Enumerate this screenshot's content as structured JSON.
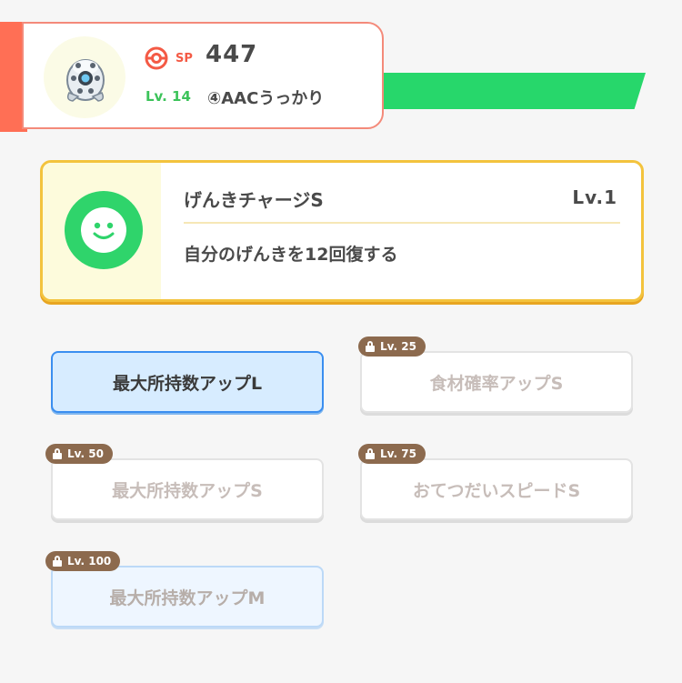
{
  "header": {
    "sp_label": "SP",
    "sp_value": "447",
    "level_label": "Lv. 14",
    "pokemon_name": "④AACうっかり",
    "accent_color": "#ff6f55",
    "stripe_color": "#27d76b"
  },
  "main_skill": {
    "name": "げんきチャージS",
    "level": "Lv.1",
    "description": "自分のげんきを12回復する",
    "icon": "smiley-face-icon",
    "icon_color": "#2fd46b"
  },
  "sub_skills": [
    {
      "label": "最大所持数アップL",
      "lock_level": "",
      "state": "unlocked"
    },
    {
      "label": "食材確率アップS",
      "lock_level": "Lv. 25",
      "state": "locked"
    },
    {
      "label": "最大所持数アップS",
      "lock_level": "Lv. 50",
      "state": "locked"
    },
    {
      "label": "おてつだいスピードS",
      "lock_level": "Lv. 75",
      "state": "locked"
    },
    {
      "label": "最大所持数アップM",
      "lock_level": "Lv. 100",
      "state": "locked"
    }
  ]
}
